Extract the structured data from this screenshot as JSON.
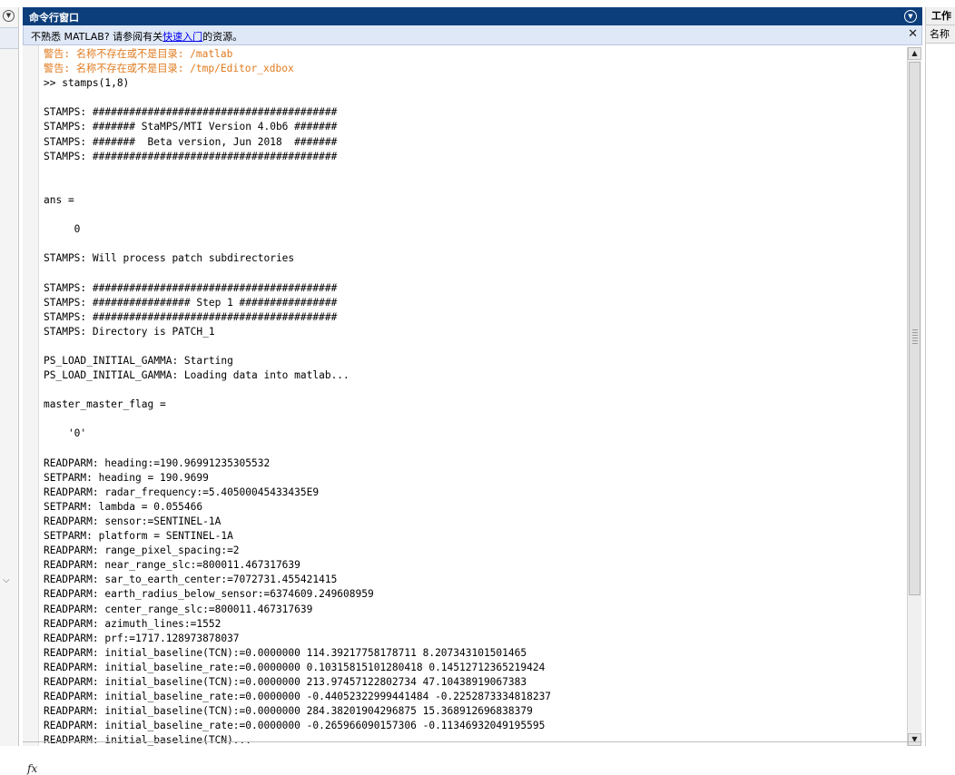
{
  "command_window": {
    "title": "命令行窗口",
    "notice": {
      "before": "不熟悉 MATLAB? 请参阅有关",
      "link": "快速入门",
      "after": "的资源。"
    },
    "lines": [
      {
        "text": "警告: 名称不存在或不是目录: /matlab",
        "type": "warn"
      },
      {
        "text": "警告: 名称不存在或不是目录: /tmp/Editor_xdbox",
        "type": "warn"
      },
      {
        "text": ">> stamps(1,8)",
        "type": "normal"
      },
      {
        "text": "",
        "type": "normal"
      },
      {
        "text": "STAMPS: ########################################",
        "type": "normal"
      },
      {
        "text": "STAMPS: ####### StaMPS/MTI Version 4.0b6 #######",
        "type": "normal"
      },
      {
        "text": "STAMPS: #######  Beta version, Jun 2018  #######",
        "type": "normal"
      },
      {
        "text": "STAMPS: ########################################",
        "type": "normal"
      },
      {
        "text": "",
        "type": "normal"
      },
      {
        "text": "",
        "type": "normal"
      },
      {
        "text": "ans =",
        "type": "normal"
      },
      {
        "text": "",
        "type": "normal"
      },
      {
        "text": "     0",
        "type": "normal"
      },
      {
        "text": "",
        "type": "normal"
      },
      {
        "text": "STAMPS: Will process patch subdirectories",
        "type": "normal"
      },
      {
        "text": "",
        "type": "normal"
      },
      {
        "text": "STAMPS: ########################################",
        "type": "normal"
      },
      {
        "text": "STAMPS: ################ Step 1 ################",
        "type": "normal"
      },
      {
        "text": "STAMPS: ########################################",
        "type": "normal"
      },
      {
        "text": "STAMPS: Directory is PATCH_1",
        "type": "normal"
      },
      {
        "text": "",
        "type": "normal"
      },
      {
        "text": "PS_LOAD_INITIAL_GAMMA: Starting",
        "type": "normal"
      },
      {
        "text": "PS_LOAD_INITIAL_GAMMA: Loading data into matlab...",
        "type": "normal"
      },
      {
        "text": "",
        "type": "normal"
      },
      {
        "text": "master_master_flag =",
        "type": "normal"
      },
      {
        "text": "",
        "type": "normal"
      },
      {
        "text": "    '0'",
        "type": "normal"
      },
      {
        "text": "",
        "type": "normal"
      },
      {
        "text": "READPARM: heading:=190.96991235305532",
        "type": "normal"
      },
      {
        "text": "SETPARM: heading = 190.9699",
        "type": "normal"
      },
      {
        "text": "READPARM: radar_frequency:=5.40500045433435E9",
        "type": "normal"
      },
      {
        "text": "SETPARM: lambda = 0.055466",
        "type": "normal"
      },
      {
        "text": "READPARM: sensor:=SENTINEL-1A",
        "type": "normal"
      },
      {
        "text": "SETPARM: platform = SENTINEL-1A",
        "type": "normal"
      },
      {
        "text": "READPARM: range_pixel_spacing:=2",
        "type": "normal"
      },
      {
        "text": "READPARM: near_range_slc:=800011.467317639",
        "type": "normal"
      },
      {
        "text": "READPARM: sar_to_earth_center:=7072731.455421415",
        "type": "normal"
      },
      {
        "text": "READPARM: earth_radius_below_sensor:=6374609.249608959",
        "type": "normal"
      },
      {
        "text": "READPARM: center_range_slc:=800011.467317639",
        "type": "normal"
      },
      {
        "text": "READPARM: azimuth_lines:=1552",
        "type": "normal"
      },
      {
        "text": "READPARM: prf:=1717.128973878037",
        "type": "normal"
      },
      {
        "text": "READPARM: initial_baseline(TCN):=0.0000000 114.39217758178711 8.207343101501465",
        "type": "normal"
      },
      {
        "text": "READPARM: initial_baseline_rate:=0.0000000 0.10315815101280418 0.14512712365219424",
        "type": "normal"
      },
      {
        "text": "READPARM: initial_baseline(TCN):=0.0000000 213.97457122802734 47.10438919067383",
        "type": "normal"
      },
      {
        "text": "READPARM: initial_baseline_rate:=0.0000000 -0.44052322999441484 -0.2252873334818237",
        "type": "normal"
      },
      {
        "text": "READPARM: initial_baseline(TCN):=0.0000000 284.38201904296875 15.368912696838379",
        "type": "normal"
      },
      {
        "text": "READPARM: initial_baseline_rate:=0.0000000 -0.265966090157306 -0.11346932049195595",
        "type": "normal"
      },
      {
        "text": "READPARM: initial_baseline(TCN)...",
        "type": "normal"
      }
    ],
    "prompt_icon": "fx"
  },
  "workspace": {
    "title": "工作",
    "column": "名称"
  },
  "icons": {
    "panel_menu": "chevron-circle-down-icon",
    "close": "close-icon",
    "fx": "function-fx-icon"
  },
  "colors": {
    "title_bar": "#0c3e7b",
    "notice_bg": "#dfe8f7",
    "warning_text": "#e07a1e",
    "link": "#0000ee"
  }
}
